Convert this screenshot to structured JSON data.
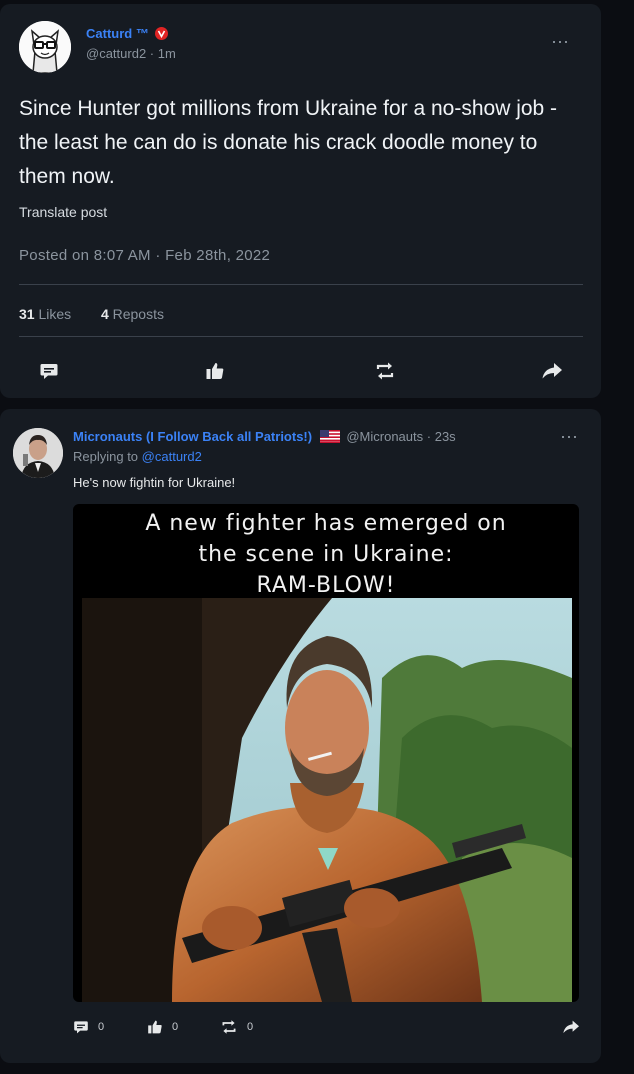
{
  "post": {
    "display_name": "Catturd ™",
    "handle": "@catturd2",
    "separator": "·",
    "time": "1m",
    "text": "Since Hunter got millions from Ukraine for a no-show job - the least he can do is donate his crack doodle money to them now.",
    "translate_label": "Translate post",
    "posted_on": "Posted on 8:07 AM · Feb 28th, 2022",
    "likes_count": "31",
    "likes_label": "Likes",
    "reposts_count": "4",
    "reposts_label": "Reposts",
    "more_icon": "more-horizontal-icon",
    "verified_badge_color": "#e02424"
  },
  "reply": {
    "display_name": "Micronauts (I Follow Back all Patriots!)",
    "flag_icon": "us-flag-icon",
    "handle": "@Micronauts",
    "separator": "·",
    "time": "23s",
    "replying_prefix": "Replying to",
    "replying_to": "@catturd2",
    "text": "He's now fightin for Ukraine!",
    "meme_caption_lines": [
      "A new fighter has emerged on",
      "the scene in Ukraine:",
      "RAM-BLOW!"
    ],
    "comment_count": "0",
    "like_count": "0",
    "repost_count": "0"
  },
  "colors": {
    "accent": "#3b82f6",
    "background": "#0b0d12",
    "card": "#161b22",
    "muted": "#8b949e"
  }
}
